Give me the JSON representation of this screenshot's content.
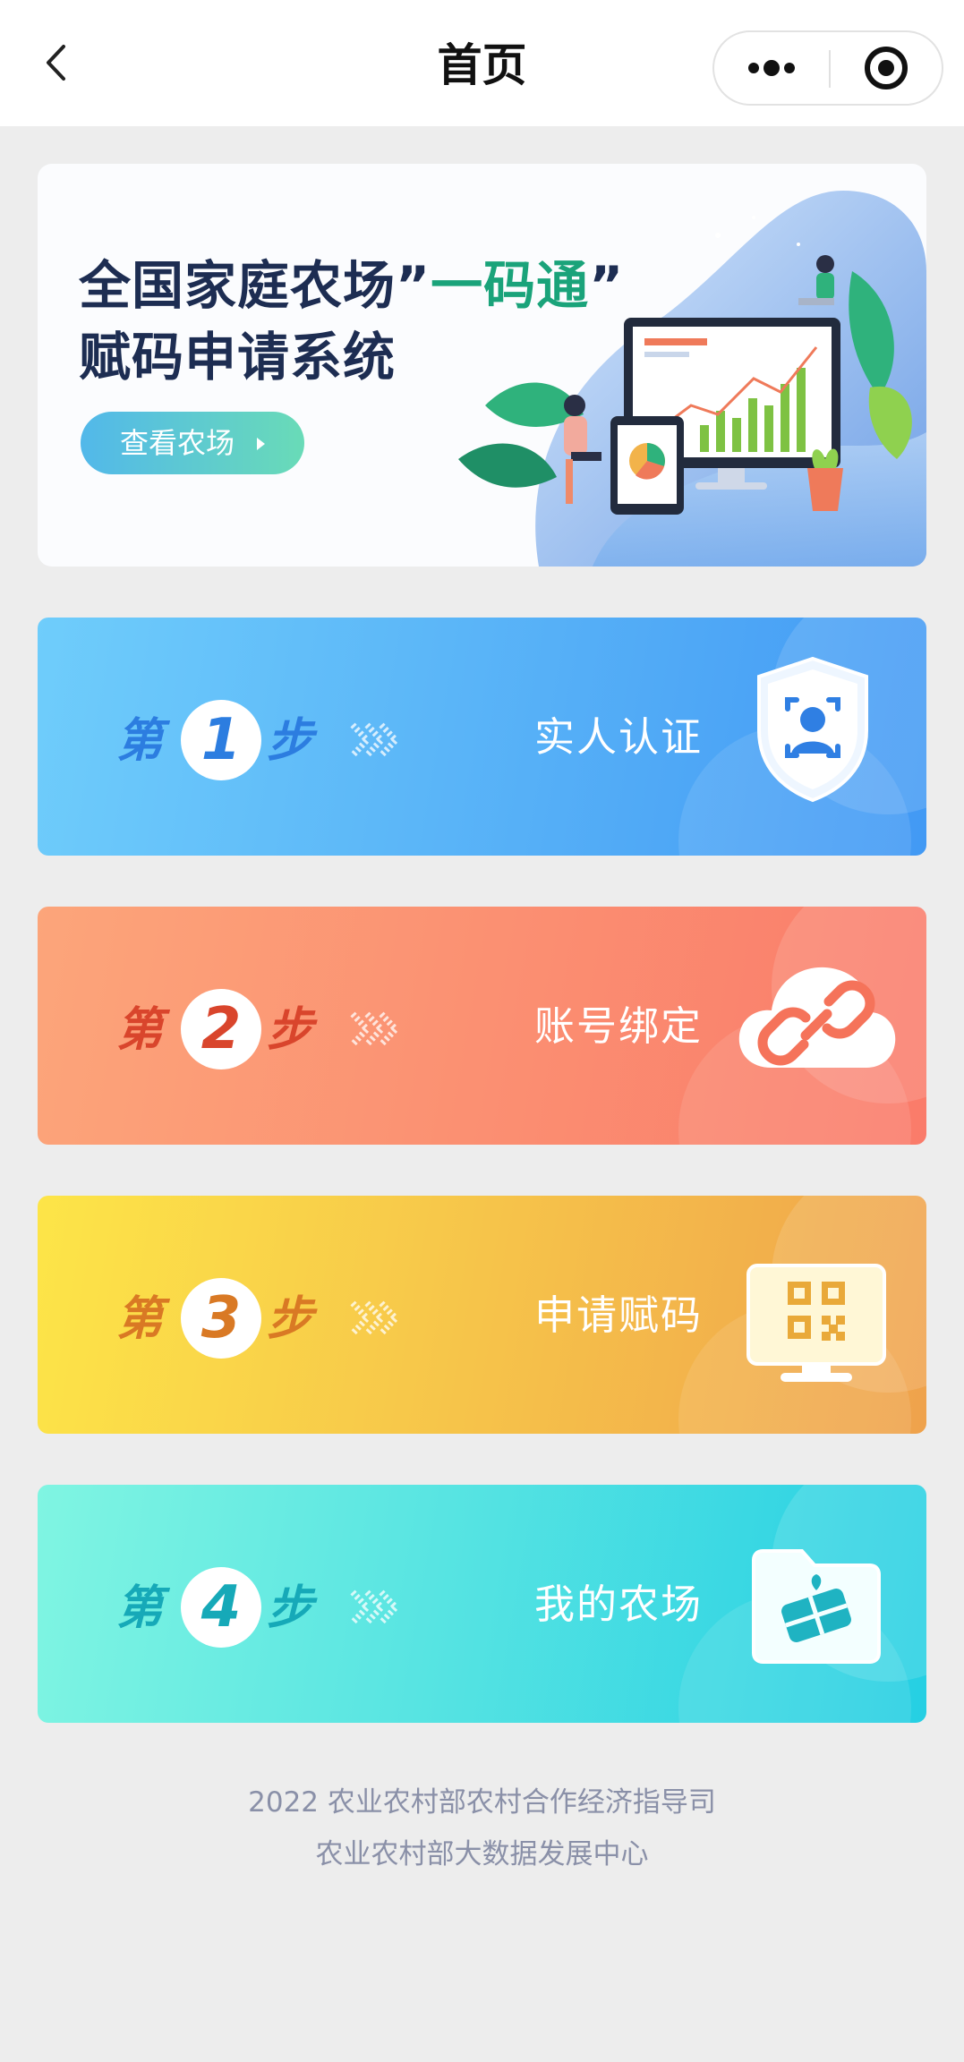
{
  "nav": {
    "title": "首页",
    "back_icon": "chevron-left-icon",
    "more_icon": "more-dots-icon",
    "close_icon": "target-circle-icon"
  },
  "banner": {
    "title_line1_pre": "全国家庭农场”",
    "title_line1_accent": "一码通",
    "title_line1_post": "”",
    "title_line2": "赋码申请系统",
    "button_label": "查看农场"
  },
  "steps": [
    {
      "prefix": "第",
      "number": "1",
      "suffix": "步",
      "label": "实人认证",
      "icon": "face-id-shield-icon",
      "gradient": [
        "#6fcdfb",
        "#4299f4"
      ],
      "accent": "#2c7de0"
    },
    {
      "prefix": "第",
      "number": "2",
      "suffix": "步",
      "label": "账号绑定",
      "icon": "cloud-link-icon",
      "gradient": [
        "#fca57a",
        "#fa7b6a"
      ],
      "accent": "#d9452c"
    },
    {
      "prefix": "第",
      "number": "3",
      "suffix": "步",
      "label": "申请赋码",
      "icon": "qr-monitor-icon",
      "gradient": [
        "#fde548",
        "#efa24c"
      ],
      "accent": "#d97924"
    },
    {
      "prefix": "第",
      "number": "4",
      "suffix": "步",
      "label": "我的农场",
      "icon": "farm-folder-icon",
      "gradient": [
        "#80f5e2",
        "#25cfe3"
      ],
      "accent": "#16a9b8"
    }
  ],
  "footer": {
    "line1": "2022 农业农村部农村合作经济指导司",
    "line2": "农业农村部大数据发展中心"
  }
}
